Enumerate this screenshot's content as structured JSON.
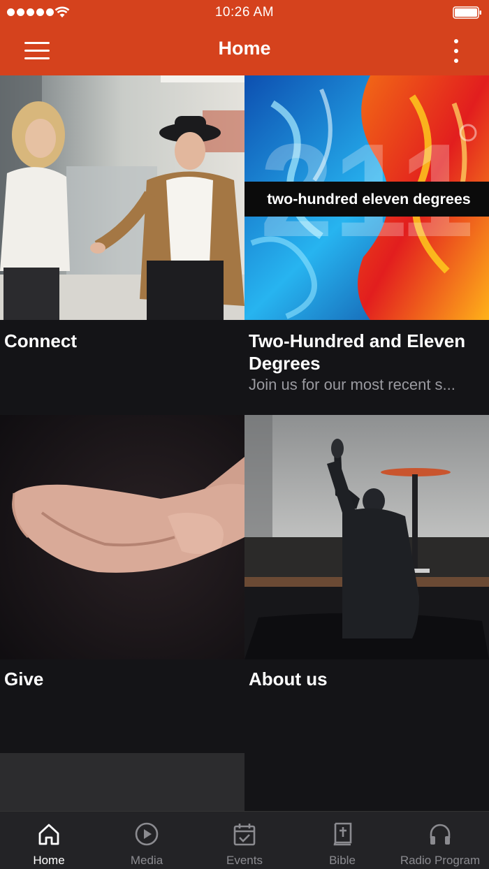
{
  "status_bar": {
    "time": "10:26 AM"
  },
  "header": {
    "title": "Home"
  },
  "tiles": [
    {
      "title": "Connect",
      "subtitle": ""
    },
    {
      "title": "Two-Hundred and Eleven Degrees",
      "subtitle": "Join us for our most recent s...",
      "banner_text": "two-hundred eleven degrees",
      "banner_numerals": "211"
    },
    {
      "title": "Give",
      "subtitle": ""
    },
    {
      "title": "About us",
      "subtitle": ""
    }
  ],
  "tabbar": {
    "items": [
      {
        "label": "Home",
        "icon": "home-icon",
        "active": true
      },
      {
        "label": "Media",
        "icon": "play-circle-icon",
        "active": false
      },
      {
        "label": "Events",
        "icon": "calendar-check-icon",
        "active": false
      },
      {
        "label": "Bible",
        "icon": "bible-icon",
        "active": false
      },
      {
        "label": "Radio Program",
        "icon": "headphones-icon",
        "active": false
      }
    ]
  },
  "colors": {
    "header_bg": "#d5421d",
    "page_bg": "#141417",
    "tabbar_bg": "#232326",
    "inactive_tab": "#8b8b90"
  }
}
